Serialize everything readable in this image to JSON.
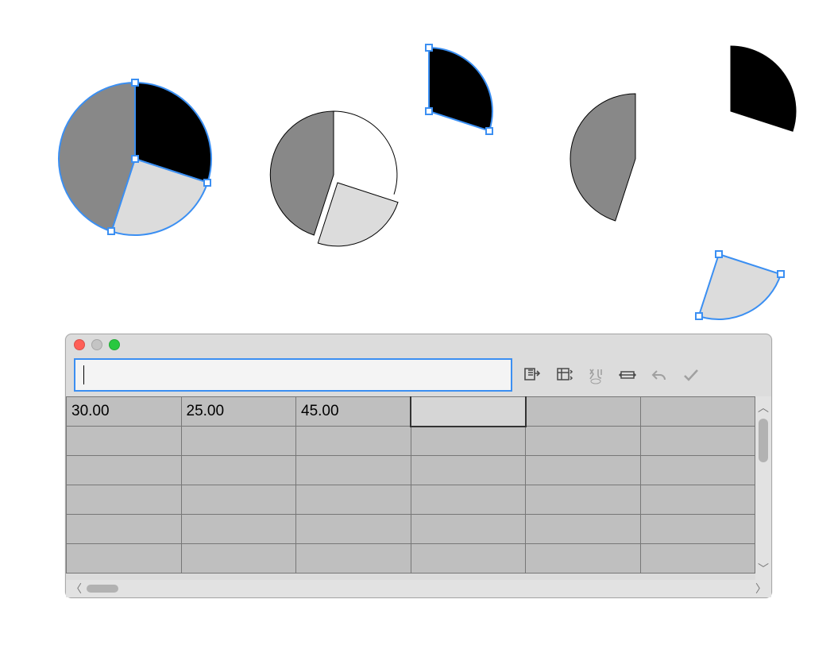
{
  "chart_data": [
    {
      "type": "pie",
      "categories": [
        "black",
        "dark-gray",
        "light-gray"
      ],
      "values": [
        30,
        45,
        25
      ],
      "title": "",
      "note": "joined pie, selected"
    },
    {
      "type": "pie",
      "categories": [
        "black",
        "dark-gray",
        "light-gray"
      ],
      "values": [
        30,
        45,
        25
      ],
      "title": "",
      "note": "partially exploded pie"
    },
    {
      "type": "pie",
      "categories": [
        "black",
        "dark-gray",
        "light-gray"
      ],
      "values": [
        30,
        45,
        25
      ],
      "title": "",
      "note": "fully separated pie, two slices selected"
    }
  ],
  "colors": {
    "slice_black": "#000000",
    "slice_dark": "#888888",
    "slice_light": "#dcdcdc",
    "selection": "#3b8ff2"
  },
  "data_window": {
    "formula_value": "",
    "toolbar": {
      "import_icon": "import",
      "swap_rc_icon": "swap-rows-cols",
      "swap_xy_icon": "swap-xy",
      "cell_size_icon": "cell-size",
      "undo_icon": "undo",
      "confirm_icon": "confirm"
    },
    "table": {
      "rows": [
        [
          "30.00",
          "25.00",
          "45.00",
          "",
          "",
          ""
        ],
        [
          "",
          "",
          "",
          "",
          "",
          ""
        ],
        [
          "",
          "",
          "",
          "",
          "",
          ""
        ],
        [
          "",
          "",
          "",
          "",
          "",
          ""
        ],
        [
          "",
          "",
          "",
          "",
          "",
          ""
        ],
        [
          "",
          "",
          "",
          "",
          "",
          ""
        ]
      ],
      "active_cell": {
        "row": 0,
        "col": 3
      }
    }
  }
}
